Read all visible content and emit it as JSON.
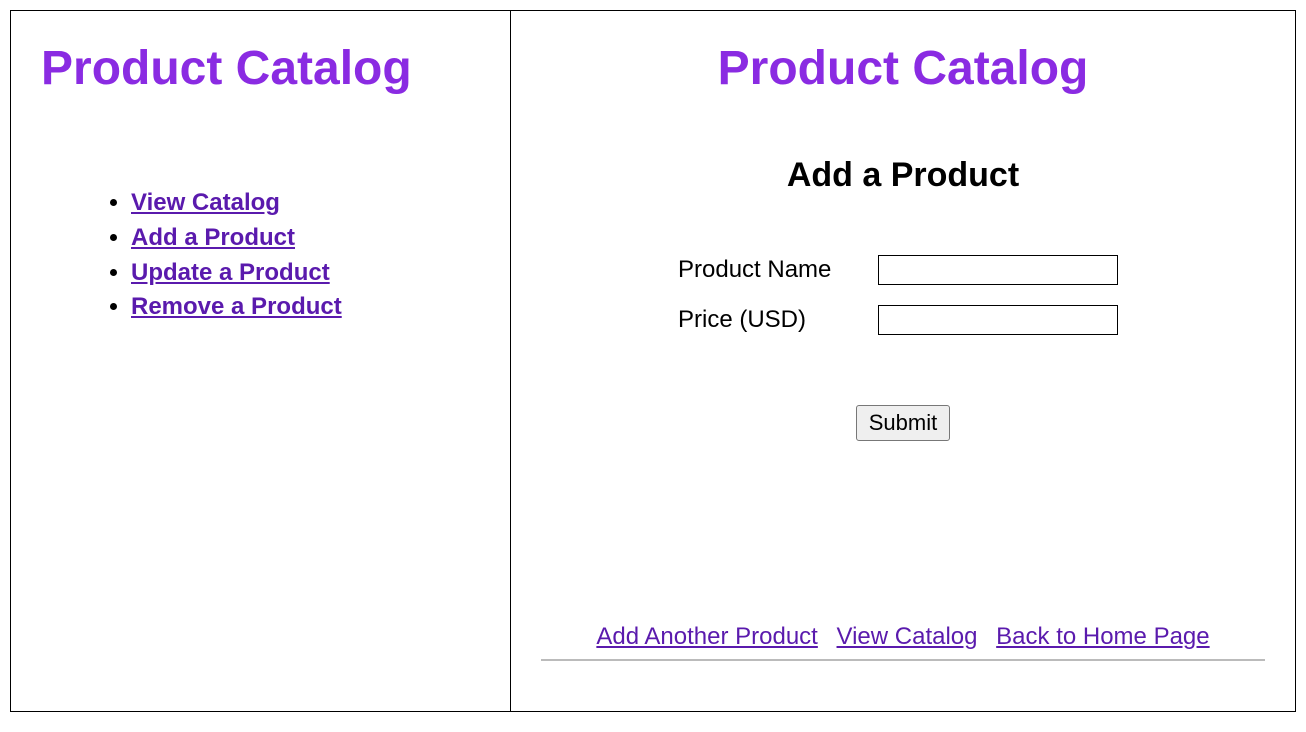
{
  "left": {
    "title": "Product Catalog",
    "nav": [
      "View Catalog",
      "Add a Product",
      "Update a Product",
      "Remove a Product"
    ]
  },
  "right": {
    "title": "Product Catalog",
    "section_title": "Add a Product",
    "form": {
      "product_name_label": "Product Name",
      "product_name_value": "",
      "price_label": "Price (USD)",
      "price_value": "",
      "submit_label": "Submit"
    },
    "footer": {
      "add_another": "Add Another Product",
      "view_catalog": "View Catalog",
      "back_home": "Back to Home Page"
    }
  }
}
